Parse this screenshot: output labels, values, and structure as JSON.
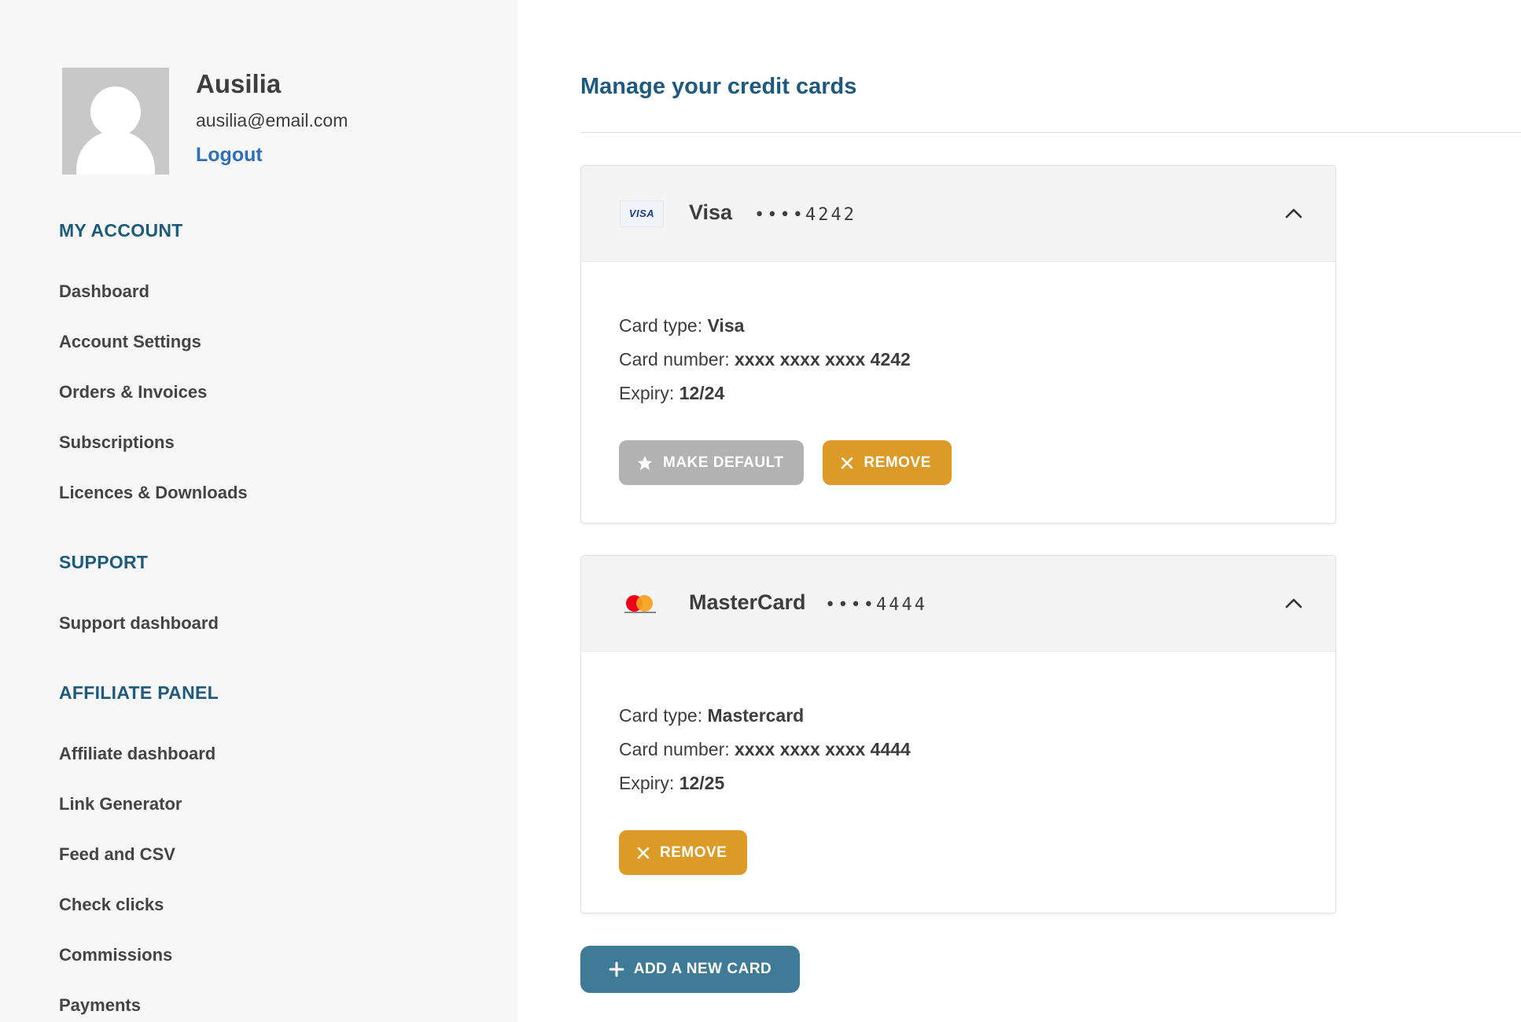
{
  "user": {
    "name": "Ausilia",
    "email": "ausilia@email.com",
    "logout_label": "Logout"
  },
  "sidebar": {
    "sections": [
      {
        "title": "MY ACCOUNT",
        "items": [
          "Dashboard",
          "Account Settings",
          "Orders & Invoices",
          "Subscriptions",
          "Licences & Downloads"
        ]
      },
      {
        "title": "SUPPORT",
        "items": [
          "Support dashboard"
        ]
      },
      {
        "title": "AFFILIATE PANEL",
        "items": [
          "Affiliate dashboard",
          "Link Generator",
          "Feed and CSV",
          "Check clicks",
          "Commissions",
          "Payments"
        ]
      }
    ]
  },
  "main": {
    "title": "Manage your credit cards",
    "cards": [
      {
        "brand": "Visa",
        "masked": "••••4242",
        "logo": "visa-logo",
        "logo_text": "VISA",
        "type_label": "Card type: ",
        "type_value": "Visa",
        "number_label": "Card number: ",
        "number_value": "xxxx xxxx xxxx 4242",
        "expiry_label": "Expiry: ",
        "expiry_value": "12/24",
        "make_default_label": "MAKE DEFAULT",
        "remove_label": "REMOVE"
      },
      {
        "brand": "MasterCard",
        "masked": "••••4444",
        "logo": "mastercard-logo",
        "type_label": "Card type: ",
        "type_value": "Mastercard",
        "number_label": "Card number: ",
        "number_value": "xxxx xxxx xxxx 4444",
        "expiry_label": "Expiry: ",
        "expiry_value": "12/25",
        "remove_label": "REMOVE"
      }
    ],
    "add_card_label": "ADD A NEW CARD"
  },
  "colors": {
    "accent_heading": "#1e5a7d",
    "link": "#2e6fb7",
    "remove_button": "#dc9a26",
    "make_default_button": "#b2b2b2",
    "add_button": "#3f7b97"
  }
}
